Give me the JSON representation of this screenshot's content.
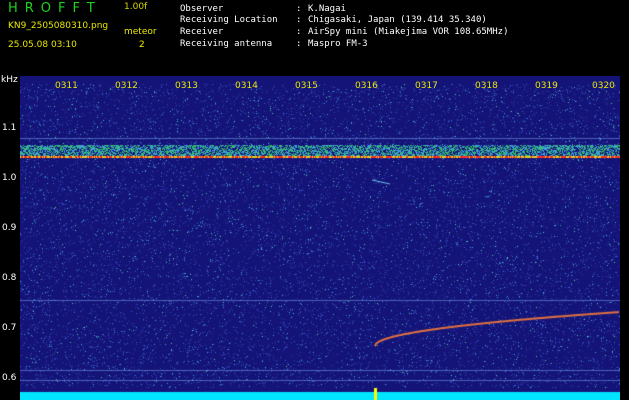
{
  "header": {
    "app_title": "HROFFT",
    "version": "1.00f",
    "filename": "KN9_2505080310.png",
    "mode_label": "meteor",
    "mode_value": "2",
    "datetime": "25.05.08 03:10",
    "fields": [
      {
        "label": "Observer",
        "value": "K.Nagai"
      },
      {
        "label": "Receiving Location",
        "value": "Chigasaki, Japan (139.414 35.340)"
      },
      {
        "label": "Receiver",
        "value": "AirSpy mini (Miakejima VOR 108.65MHz)"
      },
      {
        "label": "Receiving antenna",
        "value": "Maspro FM-3"
      }
    ]
  },
  "spectrogram": {
    "y_unit": "kHz",
    "y_ticks": [
      "1.1",
      "1.0",
      "0.9",
      "0.8",
      "0.7",
      "0.6"
    ],
    "time_ticks": [
      "0311",
      "0312",
      "0313",
      "0314",
      "0315",
      "0316",
      "0317",
      "0318",
      "0319",
      "0320"
    ],
    "colors": {
      "background": "#1a1a8c",
      "axis_text": "#e8e800",
      "bottom_bar": "#00e5ff",
      "carrier": "#ff3020"
    }
  }
}
